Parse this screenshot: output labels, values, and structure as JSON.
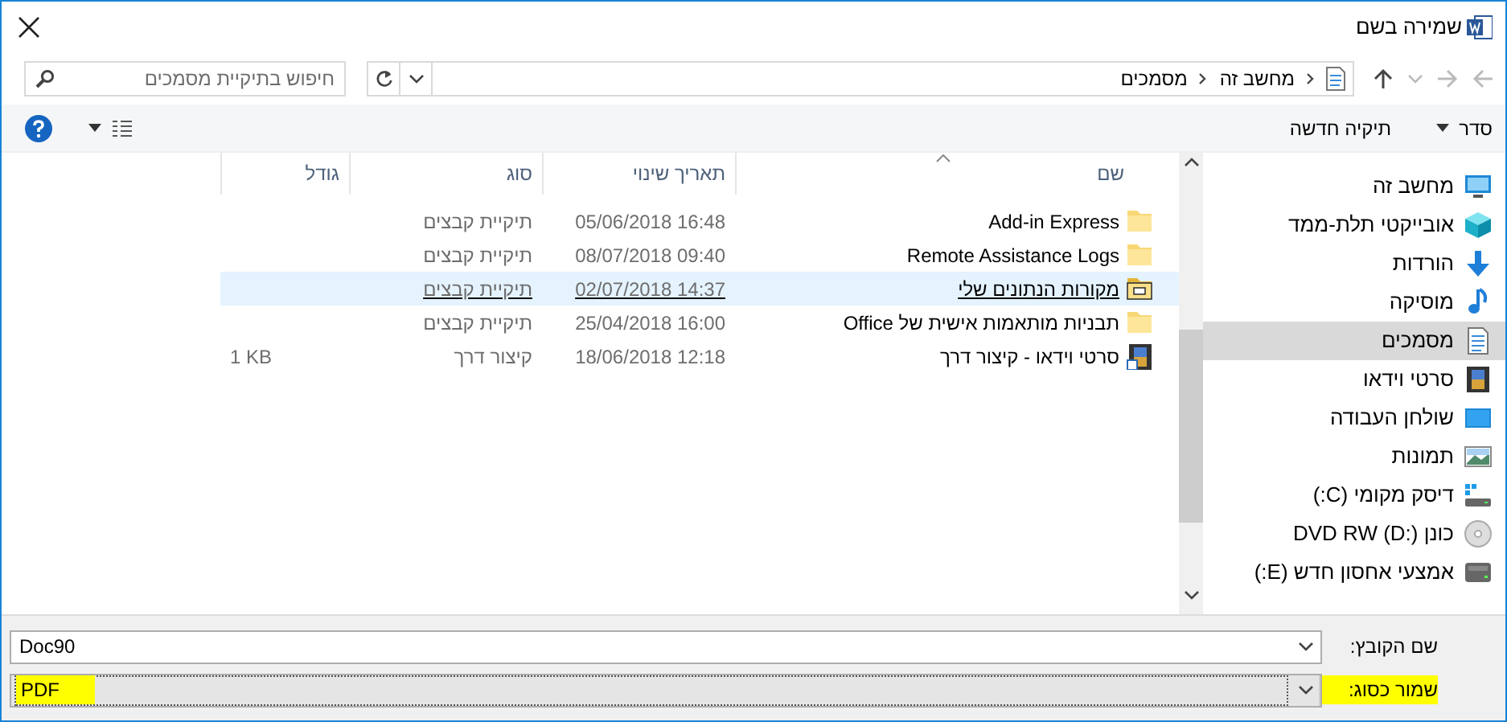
{
  "window": {
    "title": "שמירה בשם"
  },
  "navigation": {
    "breadcrumbs": [
      "מחשב זה",
      "מסמכים"
    ],
    "search": {
      "placeholder": "חיפוש בתיקיית מסמכים"
    }
  },
  "toolbar": {
    "items": [
      {
        "label": "סדר",
        "kind": "menu"
      },
      {
        "label": "תיקיה חדשה",
        "kind": "button"
      }
    ]
  },
  "sidebar": {
    "items": [
      {
        "label": "מחשב זה",
        "kind": "computer",
        "selected": false
      },
      {
        "label": "אובייקטי תלת-ממד",
        "kind": "cube",
        "selected": false
      },
      {
        "label": "הורדות",
        "kind": "download",
        "selected": false
      },
      {
        "label": "מוסיקה",
        "kind": "music",
        "selected": false
      },
      {
        "label": "מסמכים",
        "kind": "document",
        "selected": true
      },
      {
        "label": "סרטי וידאו",
        "kind": "video",
        "selected": false
      },
      {
        "label": "שולחן העבודה",
        "kind": "desktop",
        "selected": false
      },
      {
        "label": "תמונות",
        "kind": "pictures",
        "selected": false
      },
      {
        "label": "דיסק מקומי (C:)",
        "kind": "system-drive",
        "selected": false
      },
      {
        "label": "כונן DVD RW (D:)",
        "kind": "disc",
        "selected": false
      },
      {
        "label": "אמצעי אחסון חדש (E:)",
        "kind": "drive",
        "selected": false
      }
    ]
  },
  "file_list": {
    "columns": [
      "שם",
      "תאריך שינוי",
      "סוג",
      "גודל"
    ],
    "rows": [
      {
        "name": "Add-in Express",
        "date": "05/06/2018 16:48",
        "type": "תיקיית קבצים",
        "kind": "folder",
        "selected": false
      },
      {
        "name": "Remote Assistance Logs",
        "date": "08/07/2018 09:40",
        "type": "תיקיית קבצים",
        "kind": "folder",
        "selected": false
      },
      {
        "name": "מקורות הנתונים שלי",
        "date": "02/07/2018 14:37",
        "type": "תיקיית קבצים",
        "kind": "data-folder",
        "selected": true
      },
      {
        "name": "תבניות מותאמות אישית של Office",
        "date": "25/04/2018 16:00",
        "type": "תיקיית קבצים",
        "kind": "folder",
        "selected": false
      },
      {
        "name": "סרטי וידאו - קיצור דרך",
        "date": "18/06/2018 12:18",
        "type": "קיצור דרך",
        "size": "1 KB",
        "kind": "video-shortcut",
        "selected": false
      }
    ]
  },
  "form": {
    "fields": [
      {
        "label": "שם הקובץ:",
        "value": "Doc90",
        "highlighted": false
      },
      {
        "label": "שמור כסוג:",
        "value": "PDF",
        "highlighted": true
      }
    ]
  }
}
